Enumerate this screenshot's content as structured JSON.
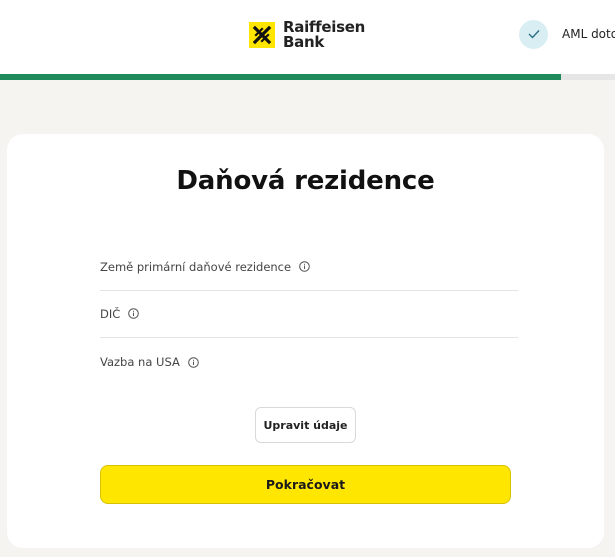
{
  "header": {
    "logo_line1": "Raiffeisen",
    "logo_line2": "Bank",
    "step_label": "AML doto"
  },
  "progress": {
    "fraction": 0.913
  },
  "colors": {
    "brand_yellow": "#ffe600",
    "progress_green": "#1f8a5a",
    "step_bg": "#d9eef2"
  },
  "card": {
    "title": "Daňová rezidence",
    "fields": [
      {
        "label": "Země primární daňové rezidence"
      },
      {
        "label": "DIČ"
      },
      {
        "label": "Vazba na USA"
      }
    ],
    "edit_label": "Upravit údaje",
    "continue_label": "Pokračovat"
  }
}
